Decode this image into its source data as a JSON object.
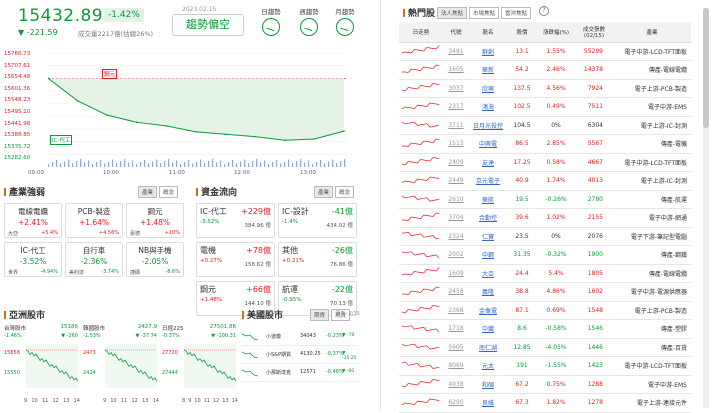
{
  "header": {
    "index_value": "15432.89",
    "index_pct": "-1.42%",
    "index_change": "▼ -221.59",
    "volume_text": "成交量2217億(估總26%)",
    "date": "2023.02.15",
    "trend_label": "趨勢偏空",
    "trend_buttons": [
      "日趨勢",
      "週趨勢",
      "月趨勢"
    ]
  },
  "main_chart": {
    "y_ticks": [
      "15760.73",
      "15707.61",
      "15654.48",
      "15601.36",
      "15548.23",
      "15495.10",
      "15441.98",
      "15388.85",
      "15335.72",
      "15282.60"
    ],
    "x_ticks": [
      "09:00",
      "10:00",
      "11:00",
      "12:00",
      "13:00"
    ],
    "marker_high": "鋼元",
    "marker_low": "IC-代工"
  },
  "chart_data": {
    "type": "line",
    "title": "",
    "x": [
      "09:00",
      "09:20",
      "09:40",
      "10:00",
      "10:30",
      "11:00",
      "11:30",
      "12:00",
      "12:30",
      "13:00",
      "13:30"
    ],
    "values": [
      15655,
      15560,
      15500,
      15470,
      15455,
      15430,
      15420,
      15410,
      15395,
      15400,
      15432.89
    ],
    "ylim": [
      15282.6,
      15760.73
    ],
    "colors": {
      "line": "#0a9a3a",
      "fill": "#e4f3e6",
      "ref": "#e02020"
    }
  },
  "industry": {
    "title": "產業強弱",
    "tabs": [
      "產業",
      "概念"
    ],
    "cards": [
      {
        "name": "電線電纜",
        "pct": "+2.41%",
        "left": "大亞",
        "right": "+5.4%",
        "color": "red"
      },
      {
        "name": "PCB-製造",
        "pct": "+1.64%",
        "left": "",
        "right": "+4.56%",
        "color": "red"
      },
      {
        "name": "鋼元",
        "pct": "+1.48%",
        "left": "豪德",
        "right": "+10%",
        "color": "red"
      },
      {
        "name": "IC-代工",
        "pct": "-3.52%",
        "left": "世界",
        "right": "-4.94%",
        "color": "green"
      },
      {
        "name": "自行車",
        "pct": "-2.36%",
        "left": "美利達",
        "right": "-3.74%",
        "color": "green"
      },
      {
        "name": "NB與手機",
        "pct": "-2.05%",
        "left": "捷碼",
        "right": "-8.6%",
        "color": "green"
      }
    ]
  },
  "fund": {
    "title": "資金流向",
    "tabs": [
      "產業",
      "概念"
    ],
    "cards": [
      {
        "name": "IC-代工",
        "val": "+229億",
        "pct": "-3.52%",
        "amt": "384.96 億",
        "color": "red"
      },
      {
        "name": "IC-設計",
        "val": "-41億",
        "pct": "-1.4%",
        "amt": "434.02 億",
        "color": "green"
      },
      {
        "name": "電機",
        "val": "+78億",
        "pct": "+0.27%",
        "amt": "158.62 億",
        "color": "red"
      },
      {
        "name": "其他",
        "val": "-26億",
        "pct": "+0.21%",
        "amt": "76.86 億",
        "color": "green"
      },
      {
        "name": "鋼元",
        "val": "+66億",
        "pct": "+1.48%",
        "amt": "144.10 億",
        "color": "red"
      },
      {
        "name": "航運",
        "val": "-22億",
        "pct": "-0.95%",
        "amt": "70.13 億",
        "color": "green"
      }
    ]
  },
  "asia": {
    "title": "亞洲股市",
    "markets": [
      {
        "name": "台灣股市",
        "value": "15186",
        "pct": "-1.46%",
        "chg": "▼ -260",
        "hi": "15658",
        "lo": "15550",
        "x": [
          "9",
          "10",
          "11",
          "12",
          "13",
          "14"
        ]
      },
      {
        "name": "韓國股市",
        "value": "2427.9",
        "pct": "-1.53%",
        "chg": "▼ -37.74",
        "hi": "2473",
        "lo": "2424",
        "x": [
          "9",
          "10",
          "11",
          "12",
          "13",
          "14"
        ]
      },
      {
        "name": "日經225",
        "value": "27501.86",
        "pct": "-0.37%",
        "chg": "▼ -100.31",
        "hi": "27720",
        "lo": "27444",
        "x": [
          "8",
          "9",
          "10",
          "11",
          "12",
          "13",
          "14"
        ]
      }
    ]
  },
  "us": {
    "title": "美國股市",
    "tabs": [
      "期貨",
      "現貨"
    ],
    "update": "更新: 2/15",
    "rows": [
      {
        "name": "小道瓊",
        "value": "34043",
        "pct": "-0.23%",
        "chg": "▼ -78"
      },
      {
        "name": "小S&P期貨",
        "value": "4130.25",
        "pct": "-0.37%",
        "chg": "▼ -15.25"
      },
      {
        "name": "小那斯達克",
        "value": "12571",
        "pct": "-0.48%",
        "chg": "▼ -60"
      }
    ]
  },
  "hot": {
    "title": "熱門股",
    "tabs": [
      "法人焦點",
      "市場焦點",
      "當沖焦點"
    ],
    "headers": [
      "日走勢",
      "代號",
      "股名",
      "股價",
      "漲跌幅(%)",
      "成交張數(02/15)",
      "產業"
    ],
    "rows": [
      {
        "code": "3481",
        "name": "群創",
        "price": "13.1",
        "pct": "1.55%",
        "vol": "55299",
        "ind": "電子中游-LCD-TFT面板",
        "up": true
      },
      {
        "code": "1605",
        "name": "華新",
        "price": "54.2",
        "pct": "2.46%",
        "vol": "14378",
        "ind": "傳產-電線電纜",
        "up": true
      },
      {
        "code": "3037",
        "name": "欣興",
        "price": "137.5",
        "pct": "4.56%",
        "vol": "7924",
        "ind": "電子上游-PCB-製造",
        "up": true
      },
      {
        "code": "2317",
        "name": "鴻海",
        "price": "102.5",
        "pct": "0.49%",
        "vol": "7511",
        "ind": "電子中游-EMS",
        "up": true
      },
      {
        "code": "3711",
        "name": "日月光投控",
        "price": "104.5",
        "pct": "0%",
        "vol": "6304",
        "ind": "電子上游-IC-封測",
        "up": null
      },
      {
        "code": "1513",
        "name": "中興電",
        "price": "86.5",
        "pct": "2.85%",
        "vol": "5567",
        "ind": "傳產-電機",
        "up": true
      },
      {
        "code": "2409",
        "name": "友達",
        "price": "17.25",
        "pct": "0.58%",
        "vol": "4667",
        "ind": "電子中游-LCD-TFT面板",
        "up": true
      },
      {
        "code": "2449",
        "name": "京元電子",
        "price": "40.9",
        "pct": "1.74%",
        "vol": "4013",
        "ind": "電子上游-IC-封測",
        "up": true
      },
      {
        "code": "2610",
        "name": "華航",
        "price": "19.5",
        "pct": "-0.26%",
        "vol": "2780",
        "ind": "傳產-航運",
        "up": false
      },
      {
        "code": "3704",
        "name": "合勤控",
        "price": "39.6",
        "pct": "1.02%",
        "vol": "2155",
        "ind": "電子中游-網通",
        "up": true
      },
      {
        "code": "2324",
        "name": "仁寶",
        "price": "23.5",
        "pct": "0%",
        "vol": "2076",
        "ind": "電子下游-筆記型電腦",
        "up": null
      },
      {
        "code": "2002",
        "name": "中鋼",
        "price": "31.35",
        "pct": "-0.32%",
        "vol": "1900",
        "ind": "傳產-鋼鐵",
        "up": false
      },
      {
        "code": "1609",
        "name": "大亞",
        "price": "24.4",
        "pct": "5.4%",
        "vol": "1805",
        "ind": "傳產-電線電纜",
        "up": true
      },
      {
        "code": "2458",
        "name": "義隆",
        "price": "38.8",
        "pct": "4.86%",
        "vol": "1602",
        "ind": "電子中游-電源供應器",
        "up": true
      },
      {
        "code": "2368",
        "name": "金像電",
        "price": "87.1",
        "pct": "0.69%",
        "vol": "1548",
        "ind": "電子上游-PCB-製造",
        "up": true
      },
      {
        "code": "1718",
        "name": "中纖",
        "price": "8.6",
        "pct": "-0.58%",
        "vol": "1546",
        "ind": "傳產-塑膠",
        "up": false
      },
      {
        "code": "5905",
        "name": "南仁湖",
        "price": "12.85",
        "pct": "-4.05%",
        "vol": "1446",
        "ind": "傳產-百貨",
        "up": false
      },
      {
        "code": "8069",
        "name": "元太",
        "price": "191",
        "pct": "-1.55%",
        "vol": "1423",
        "ind": "電子中游-LCD-TFT面板",
        "up": false
      },
      {
        "code": "4938",
        "name": "和碩",
        "price": "67.2",
        "pct": "0.75%",
        "vol": "1288",
        "ind": "電子中游-EMS",
        "up": true
      },
      {
        "code": "6290",
        "name": "良維",
        "price": "67.3",
        "pct": "1.82%",
        "vol": "1278",
        "ind": "電子上游-連接元件",
        "up": true
      }
    ]
  }
}
